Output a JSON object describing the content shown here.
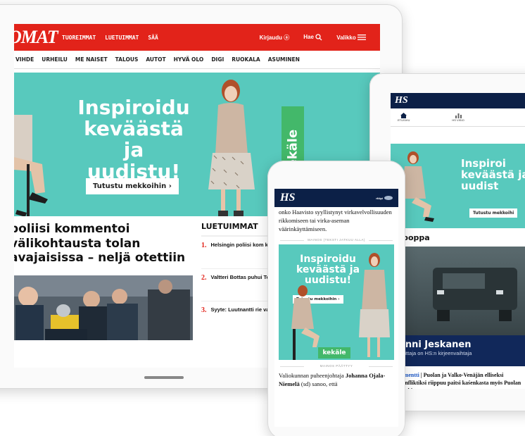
{
  "tablet": {
    "logo": "OMAT",
    "nav": [
      "TUOREIMMAT",
      "LUETUIMMAT",
      "SÄÄ"
    ],
    "login": "Kirjaudu",
    "search": "Hae",
    "menu": "Valikko",
    "subnav": [
      "VIHDE",
      "URHEILU",
      "ME NAISET",
      "TALOUS",
      "AUTOT",
      "HYVÄ OLO",
      "DIGI",
      "RUOKALA",
      "ASUMINEN"
    ],
    "ad": {
      "headline": "Inspiroidu keväästä ja uudistu!",
      "button": "Tutustu mekkoihin ›",
      "brand": "kekäle"
    },
    "headline": "poliisi kommentoi välikohtausta tolan avajaisissa – neljä otettiin",
    "sidebar_title": "LUETUIMMAT",
    "most_read": [
      {
        "num": "1.",
        "text": "Helsingin poliisi kom kohtausta KFC-ravint avajaisissa – neljä ot"
      },
      {
        "num": "2.",
        "text": "Valtteri Bottas puhui Toto Wolffin toiminn \"Kaikella on rajansa\""
      },
      {
        "num": "3.",
        "text": "Syyte: Luutnantti rie varusmiehille – \"Teki piestä sut saatana\""
      }
    ]
  },
  "ipad": {
    "logo": "HS",
    "tabs": [
      "ETUSIVU",
      "HS VISIO"
    ],
    "ad": {
      "headline": "Inspiroi keväästä ja uudist",
      "button": "Tutustu mekkoihi"
    },
    "section": "rooppa",
    "caption_name": "enni Jeskanen",
    "caption_sub": "rjoittaja on HS:n kirjeenvaihtaja",
    "body_kicker": "mmentti",
    "body_text": "| Puolan ja Valko-Venäjän elliseksi konfliktiksi riippuu paitsi kaśenkasta myös Puolan henkisest"
  },
  "phone": {
    "logo": "HS",
    "badge": "ritäpt",
    "intro": "onko Haavisto syyllistynyt virkavelvollisuuden rikkomiseen tai virka-aseman väärinkäyttämiseen.",
    "ad_start": "MAINOS (TEKSTI JATKUU ALLA)",
    "ad": {
      "headline": "Inspiroidu keväästä ja uudistu!",
      "button": "Tutustu mekkoihin ›",
      "brand": "kekäle"
    },
    "ad_end": "MAINOS PÄÄTTYY",
    "body_pre": "Valiokunnan puheenjohtaja ",
    "body_name": "Johanna Ojala-Niemelä",
    "body_post": " (sd) sanoo, että"
  },
  "colors": {
    "brand_red": "#e2231a",
    "hs_navy": "#0c2047",
    "ad_teal": "#58c9bd",
    "kekale_green": "#43b86a"
  }
}
